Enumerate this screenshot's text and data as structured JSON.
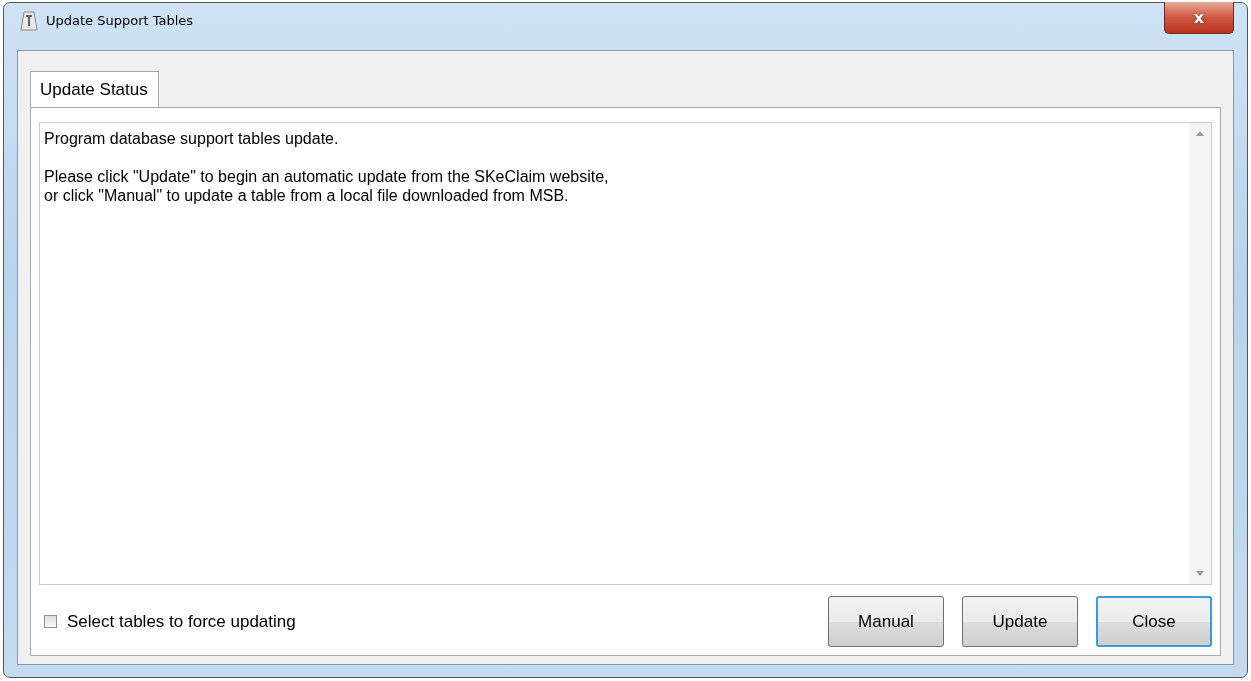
{
  "window": {
    "title": "Update Support Tables",
    "close_label": "x"
  },
  "tabs": [
    {
      "label": "Update Status",
      "selected": true
    }
  ],
  "status_text": {
    "paragraphs": [
      "Program database support tables update.",
      "Please click \"Update\" to begin an automatic update from the SKeClaim website,\nor click \"Manual\" to update a table from a local file downloaded from MSB."
    ]
  },
  "force_checkbox": {
    "label": "Select tables to force updating",
    "checked": false
  },
  "buttons": [
    {
      "label": "Manual",
      "focused": false
    },
    {
      "label": "Update",
      "focused": false
    },
    {
      "label": "Close",
      "focused": true
    }
  ]
}
